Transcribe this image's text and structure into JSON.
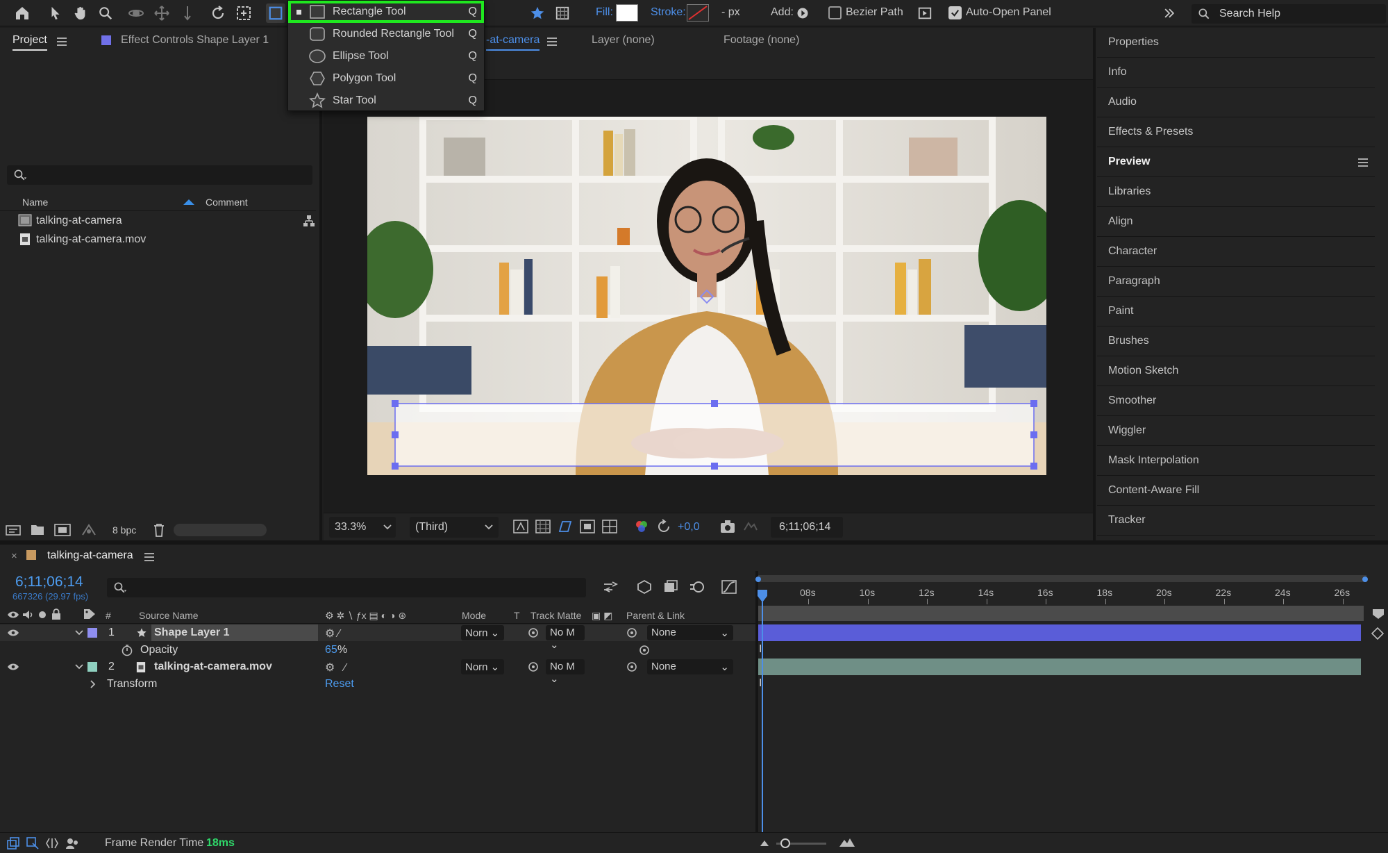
{
  "toolbar": {
    "fill_label": "Fill:",
    "stroke_label": "Stroke:",
    "stroke_unit": "- px",
    "add_label": "Add:",
    "bezier_label": "Bezier Path",
    "auto_open_label": "Auto-Open Panel",
    "search_placeholder": "Search Help",
    "fill_color": "#ffffff",
    "accent": "#4d8fe8"
  },
  "shape_menu": {
    "items": [
      {
        "label": "Rectangle Tool",
        "key": "Q",
        "icon": "rectangle-icon"
      },
      {
        "label": "Rounded Rectangle Tool",
        "key": "Q",
        "icon": "rounded-rectangle-icon"
      },
      {
        "label": "Ellipse Tool",
        "key": "Q",
        "icon": "ellipse-icon"
      },
      {
        "label": "Polygon Tool",
        "key": "Q",
        "icon": "polygon-icon"
      },
      {
        "label": "Star Tool",
        "key": "Q",
        "icon": "star-icon"
      }
    ],
    "highlight_color": "#1fe81f"
  },
  "project_panel": {
    "tab": "Project",
    "effect_controls_tab": "Effect Controls Shape Layer 1",
    "col_name": "Name",
    "col_comment": "Comment",
    "items": [
      {
        "name": "talking-at-camera"
      },
      {
        "name": "talking-at-camera.mov"
      }
    ],
    "bpc": "8 bpc"
  },
  "viewer_tabs": {
    "composition_tab": "-at-camera",
    "layer_tab": "Layer (none)",
    "footage_tab": "Footage (none)"
  },
  "viewer_bar": {
    "zoom": "33.3%",
    "resolution": "(Third)",
    "exposure": "+0,0",
    "timecode": "6;11;06;14"
  },
  "right_panel": {
    "items": [
      {
        "label": "Properties",
        "bold": false
      },
      {
        "label": "Info",
        "bold": false
      },
      {
        "label": "Audio",
        "bold": false
      },
      {
        "label": "Effects & Presets",
        "bold": false
      },
      {
        "label": "Preview",
        "bold": true
      },
      {
        "label": "Libraries",
        "bold": false
      },
      {
        "label": "Align",
        "bold": false
      },
      {
        "label": "Character",
        "bold": false
      },
      {
        "label": "Paragraph",
        "bold": false
      },
      {
        "label": "Paint",
        "bold": false
      },
      {
        "label": "Brushes",
        "bold": false
      },
      {
        "label": "Motion Sketch",
        "bold": false
      },
      {
        "label": "Smoother",
        "bold": false
      },
      {
        "label": "Wiggler",
        "bold": false
      },
      {
        "label": "Mask Interpolation",
        "bold": false
      },
      {
        "label": "Content-Aware Fill",
        "bold": false
      },
      {
        "label": "Tracker",
        "bold": false
      }
    ]
  },
  "timeline": {
    "comp_tab": "talking-at-camera",
    "timecode": "6;11;06;14",
    "frame_info": "667326 (29.97 fps)",
    "headers": {
      "num": "#",
      "source_name": "Source Name",
      "mode": "Mode",
      "t": "T",
      "track_matte": "Track Matte",
      "parent_link": "Parent & Link"
    },
    "layers": [
      {
        "num": "1",
        "name": "Shape Layer 1",
        "mode": "Norn",
        "matte": "No M",
        "parent": "None",
        "color": "#8f8ef0"
      },
      {
        "num": "2",
        "name": "talking-at-camera.mov",
        "mode": "Norn",
        "matte": "No M",
        "parent": "None",
        "color": "#8fd0c0"
      }
    ],
    "opacity_label": "Opacity",
    "opacity_value": "65",
    "opacity_unit": "%",
    "transform_label": "Transform",
    "reset_label": "Reset",
    "ruler_labels": [
      "08s",
      "10s",
      "12s",
      "14s",
      "16s",
      "18s",
      "20s",
      "22s",
      "24s",
      "26s"
    ]
  },
  "status_bar": {
    "frame_render_label": "Frame Render Time",
    "frame_render_value": "18ms"
  }
}
